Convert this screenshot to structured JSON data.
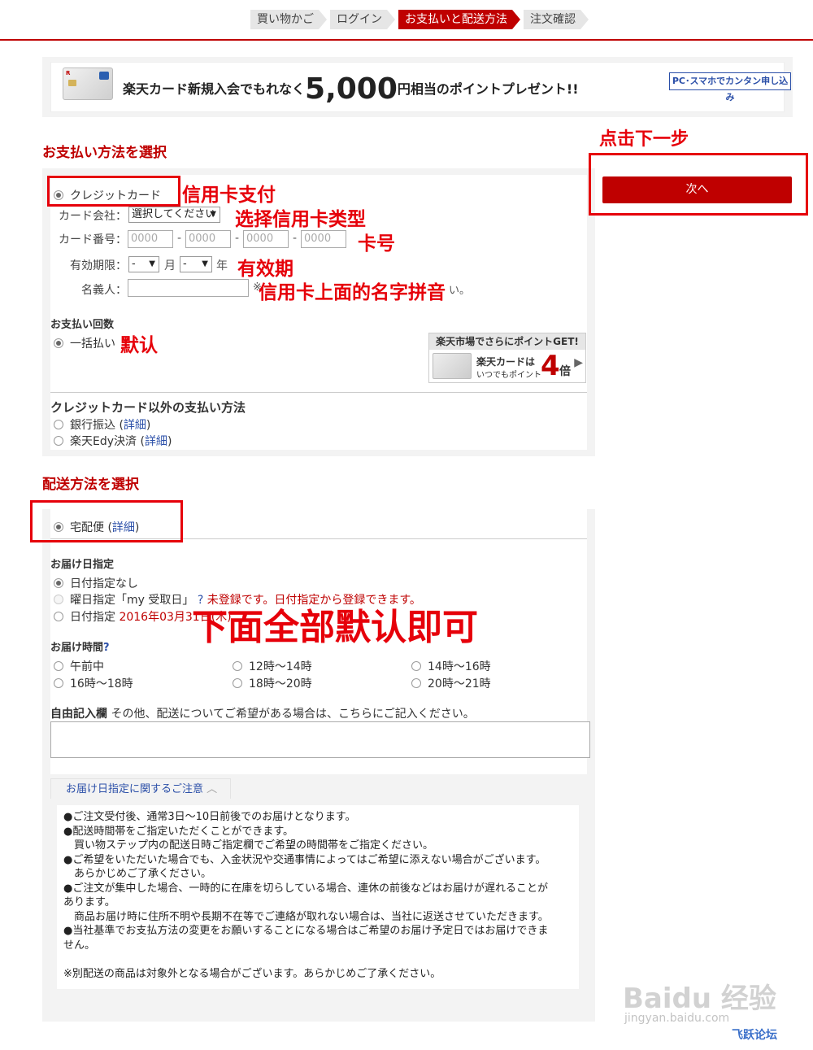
{
  "steps": [
    "買い物かご",
    "ログイン",
    "お支払いと配送方法",
    "注文確認"
  ],
  "banner": {
    "pre": "楽天カード新規入会でもれなく",
    "amount": "5,000",
    "post": "円相当のポイントプレゼント!!",
    "apply": "PC･スマホでカンタン申し込み",
    "card_logo": "R"
  },
  "payment": {
    "title": "お支払い方法を選択",
    "credit_label": "クレジットカード",
    "company_label": "カード会社：",
    "company_value": "選択してください",
    "number_label": "カード番号：",
    "number_placeholder": "0000",
    "dash": "-",
    "expiry_label": "有効期限：",
    "expiry_value": "-",
    "month": "月",
    "year": "年",
    "name_label": "名義人：",
    "name_note_a": "※",
    "name_note_b": "い。",
    "count_title": "お支払い回数",
    "count_option": "一括払い",
    "other_title": "クレジットカード以外の支払い方法",
    "other_options": [
      {
        "label": "銀行振込 (",
        "link": "詳細",
        "close": ")"
      },
      {
        "label": "楽天Edy決済 (",
        "link": "詳細",
        "close": ")"
      }
    ]
  },
  "promo": {
    "head": "楽天市場でさらにポイントGET!",
    "line1": "楽天カードは",
    "line2": "いつでもポイント",
    "num": "4",
    "bai": "倍"
  },
  "next_button": "次へ",
  "shipping": {
    "title": "配送方法を選択",
    "method": "宅配便 (",
    "method_link": "詳細",
    "method_close": ")",
    "date_title": "お届け日指定",
    "date_options": [
      "日付指定なし",
      "曜日指定「my 受取日」",
      "日付指定"
    ],
    "date_note": "未登録です。日付指定から登録できます。",
    "date_value": "2016年03月31日(木)",
    "time_title": "お届け時間",
    "times": [
      "午前中",
      "12時～14時",
      "14時～16時",
      "16時～18時",
      "18時～20時",
      "20時～21時"
    ],
    "free_title": "自由記入欄",
    "free_desc": "その他、配送についてご希望がある場合は、こちらにご記入ください。",
    "notice_tab": "お届け日指定に関するご注意",
    "notice_lines": [
      "●ご注文受付後、通常3日～10日前後でのお届けとなります。",
      "●配送時間帯をご指定いただくことができます。",
      "　買い物ステップ内の配送日時ご指定欄でご希望の時間帯をご指定ください。",
      "●ご希望をいただいた場合でも、入金状況や交通事情によってはご希望に添えない場合がございます。",
      "　あらかじめご了承ください。",
      "●ご注文が集中した場合、一時的に在庫を切らしている場合、連休の前後などはお届けが遅れることが",
      "あります。",
      "　商品お届け時に住所不明や長期不在等でご連絡が取れない場合は、当社に返送させていただきます。",
      "●当社基準でお支払方法の変更をお願いすることになる場合はご希望のお届け予定日ではお届けできま",
      "せん。",
      "",
      "※別配送の商品は対象外となる場合がございます。あらかじめご了承ください。"
    ]
  },
  "annotations": {
    "next": "点击下一步",
    "credit": "信用卡支付",
    "card_type": "选择信用卡类型",
    "card_no": "卡号",
    "expiry": "有效期",
    "name": "信用卡上面的名字拼音",
    "default": "默认",
    "all_default": "下面全部默认即可"
  },
  "watermark": {
    "main": "Baidu 经验",
    "sub": "jingyan.baidu.com",
    "site": "飞跃论坛"
  },
  "colors": {
    "brand_red": "#bf0000",
    "annotation_red": "#e6000a",
    "link_blue": "#2b4fa8"
  }
}
